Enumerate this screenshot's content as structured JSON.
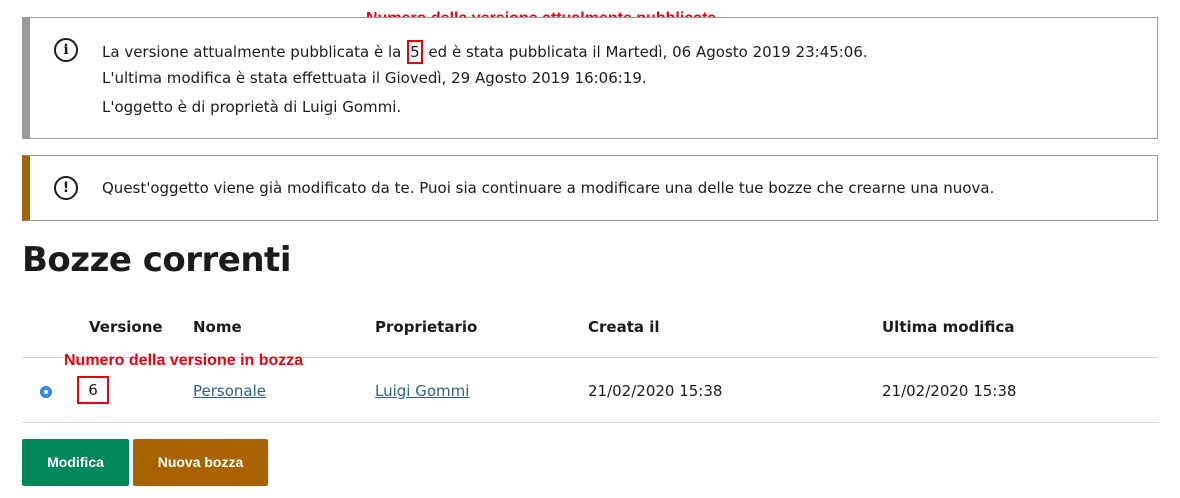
{
  "annotations": {
    "published_version": "Numero della versione attualmente pubblicata",
    "draft_version": "Numero della versione in bozza"
  },
  "info_alert": {
    "icon": "info-icon",
    "line1_pre": "La versione attualmente pubblicata è la",
    "published_version": "5",
    "line1_post": "ed è stata pubblicata il Martedì, 06 Agosto 2019 23:45:06.",
    "line2": "L'ultima modifica è stata effettuata il Giovedì, 29 Agosto 2019 16:06:19.",
    "line3": "L'oggetto è di proprietà di Luigi Gommi."
  },
  "warning_alert": {
    "icon": "exclamation-icon",
    "text": "Quest'oggetto viene già modificato da te. Puoi sia continuare a modificare una delle tue bozze che crearne una nuova."
  },
  "title": "Bozze correnti",
  "table": {
    "headers": [
      "Versione",
      "Nome",
      "Proprietario",
      "Creata il",
      "Ultima modifica"
    ],
    "rows": [
      {
        "selected": true,
        "version": "6",
        "name": "Personale",
        "owner": "Luigi Gommi",
        "created": "21/02/2020 15:38",
        "modified": "21/02/2020 15:38"
      }
    ]
  },
  "buttons": {
    "edit": "Modifica",
    "new_draft": "Nuova bozza"
  },
  "colors": {
    "annotation": "#e8000d",
    "primary_button": "#00885a",
    "secondary_button": "#a66300",
    "warning_border": "#a66300",
    "info_border": "#9a9a9a",
    "link": "#2e5e8a"
  }
}
